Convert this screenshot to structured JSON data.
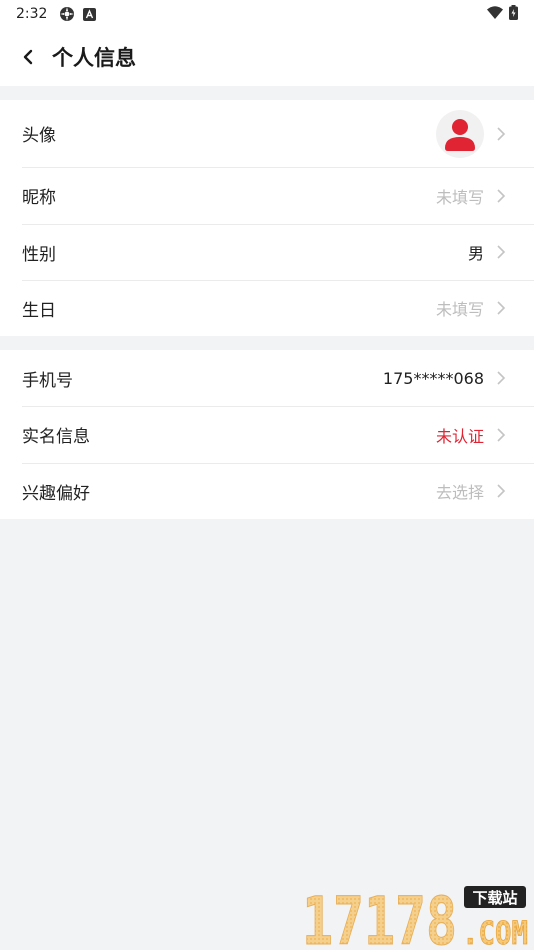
{
  "status_bar": {
    "time": "2:32"
  },
  "header": {
    "title": "个人信息"
  },
  "group1": [
    {
      "label": "头像"
    },
    {
      "label": "昵称",
      "value": "未填写"
    },
    {
      "label": "性别",
      "value": "男"
    },
    {
      "label": "生日",
      "value": "未填写"
    }
  ],
  "group2": [
    {
      "label": "手机号",
      "value": "175*****068"
    },
    {
      "label": "实名信息",
      "value": "未认证"
    },
    {
      "label": "兴趣偏好",
      "value": "去选择"
    }
  ],
  "watermark": {
    "brand": "下载站",
    "number": "17178",
    "com": ".COM"
  },
  "colors": {
    "accent_red": "#e02433",
    "placeholder": "#bdbdbd",
    "background": "#f2f3f5"
  }
}
